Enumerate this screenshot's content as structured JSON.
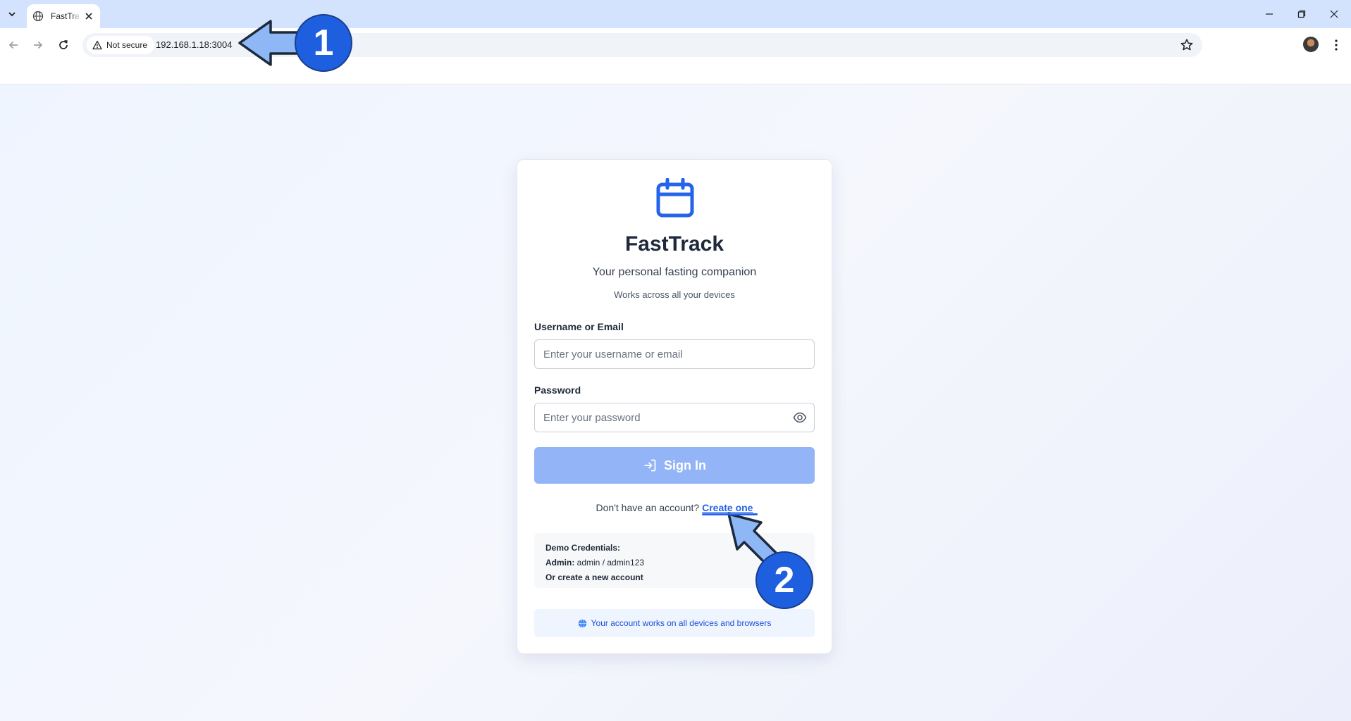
{
  "browser": {
    "tab_title": "FastTrack",
    "security_label": "Not secure",
    "url": "192.168.1.18:3004"
  },
  "login": {
    "title": "FastTrack",
    "subtitle": "Your personal fasting companion",
    "tagline": "Works across all your devices",
    "username_label": "Username or Email",
    "username_placeholder": "Enter your username or email",
    "password_label": "Password",
    "password_placeholder": "Enter your password",
    "signin_label": "Sign In",
    "signup_prompt": "Don't have an account?",
    "signup_link": "Create one",
    "demo_heading": "Demo Credentials:",
    "demo_admin_label": "Admin:",
    "demo_admin_value": "admin / admin123",
    "demo_create": "Or create a new account",
    "info_text": "Your account works on all devices and browsers"
  },
  "annotations": {
    "step1": "1",
    "step2": "2"
  },
  "colors": {
    "accent": "#2563eb",
    "button": "#93b4f6",
    "badge": "#1e5fe0",
    "arrow": "#8db8f5"
  }
}
